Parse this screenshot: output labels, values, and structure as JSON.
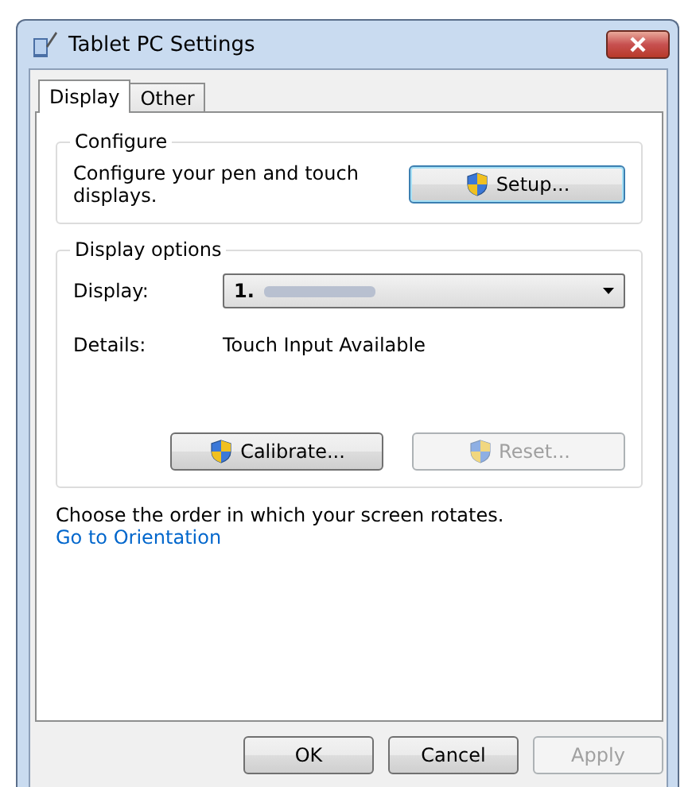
{
  "window": {
    "title": "Tablet PC Settings"
  },
  "tabs": [
    {
      "label": "Display",
      "selected": true
    },
    {
      "label": "Other",
      "selected": false
    }
  ],
  "configure": {
    "title": "Configure",
    "description": "Configure your pen and touch displays.",
    "button": {
      "label": "Setup...",
      "disabled": false
    }
  },
  "display_options": {
    "title": "Display options",
    "display_label": "Display:",
    "display_value": "1.",
    "details_label": "Details:",
    "details_value": "Touch Input Available",
    "buttons": [
      {
        "label": "Calibrate...",
        "disabled": false
      },
      {
        "label": "Reset...",
        "disabled": true
      }
    ]
  },
  "orientation": {
    "text": "Choose the order in which your screen rotates.",
    "link": "Go to Orientation"
  },
  "buttons": [
    {
      "label": "OK",
      "disabled": false
    },
    {
      "label": "Cancel",
      "disabled": false
    },
    {
      "label": "Apply",
      "disabled": true
    }
  ]
}
